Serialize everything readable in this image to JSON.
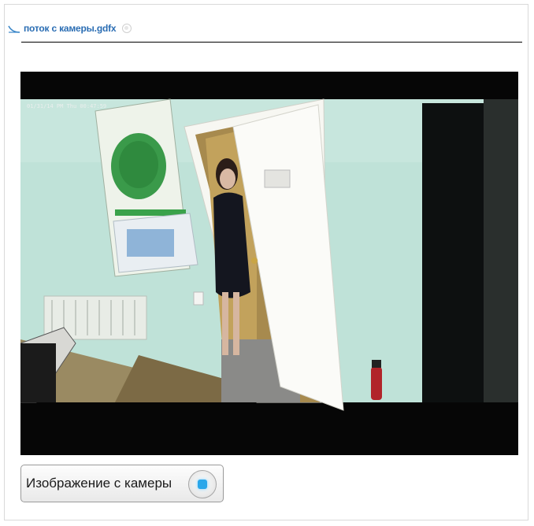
{
  "tab": {
    "icon": "flow-file-icon",
    "label": "поток с камеры.gdfx",
    "close_icon": "close-icon"
  },
  "video": {
    "osd_text": "01/31/14 PM Thu 00:47:59"
  },
  "camera_button": {
    "label": "Изображение с камеры",
    "indicator_color": "#2aa7ea"
  }
}
